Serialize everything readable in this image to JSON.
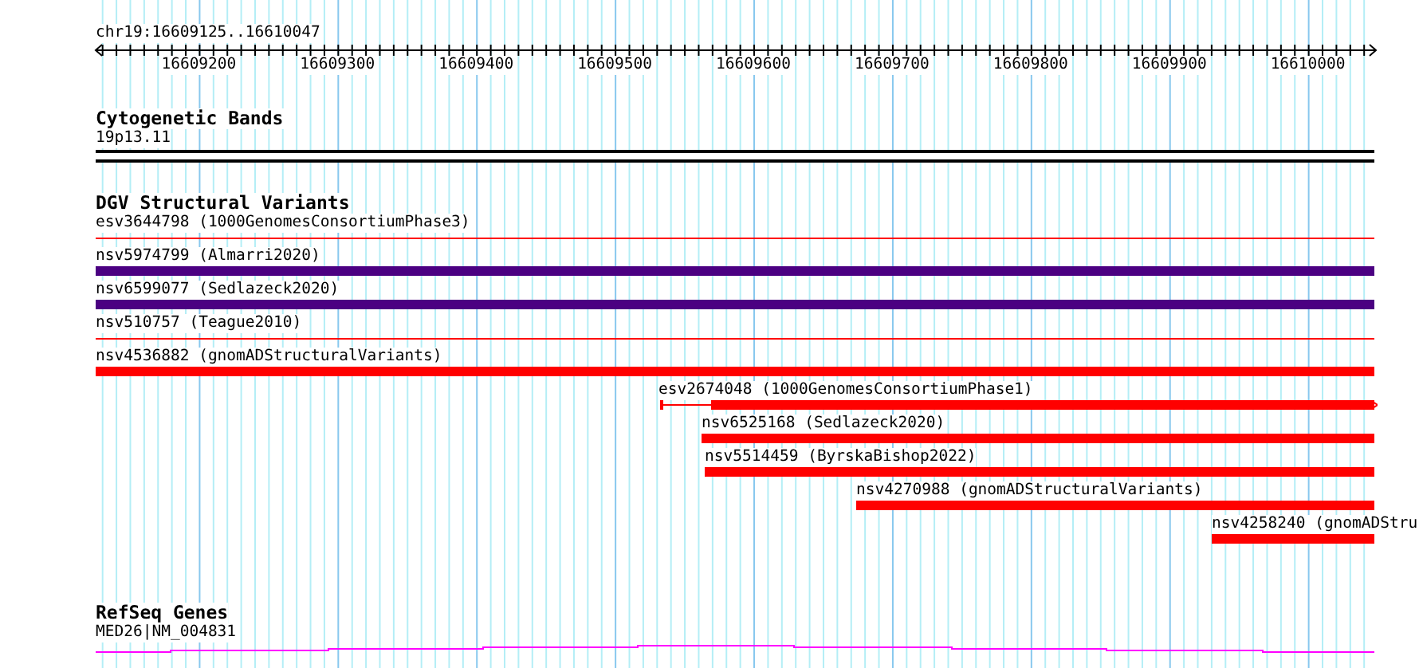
{
  "locus": "chr19:16609125..16610047",
  "ruler": {
    "labels": [
      "16609200",
      "16609300",
      "16609400",
      "16609500",
      "16609600",
      "16609700",
      "16609800",
      "16609900",
      "16610000"
    ]
  },
  "cytogenetic_bands": {
    "title": "Cytogenetic Bands",
    "features": [
      {
        "label": "19p13.11"
      }
    ]
  },
  "dgv_structural_variants": {
    "title": "DGV Structural Variants",
    "features": [
      {
        "label": "esv3644798 (1000GenomesConsortiumPhase3)",
        "kind": "line",
        "color": "#ff0000"
      },
      {
        "label": "nsv5974799 (Almarri2020)",
        "kind": "bar",
        "color": "#4b0082"
      },
      {
        "label": "nsv6599077 (Sedlazeck2020)",
        "kind": "bar",
        "color": "#4b0082"
      },
      {
        "label": "nsv510757 (Teague2010)",
        "kind": "line",
        "color": "#ff0000"
      },
      {
        "label": "nsv4536882 (gnomADStructuralVariants)",
        "kind": "bar",
        "color": "#ff0000"
      },
      {
        "label": "esv2674048 (1000GenomesConsortiumPhase1)",
        "kind": "partial",
        "color": "#ff0000"
      },
      {
        "label": "nsv6525168 (Sedlazeck2020)",
        "kind": "bar",
        "color": "#ff0000"
      },
      {
        "label": "nsv5514459 (ByrskaBishop2022)",
        "kind": "bar",
        "color": "#ff0000"
      },
      {
        "label": "nsv4270988 (gnomADStructuralVariants)",
        "kind": "bar",
        "color": "#ff0000"
      },
      {
        "label": "nsv4258240 (gnomADStru",
        "kind": "bar",
        "color": "#ff0000"
      }
    ]
  },
  "refseq_genes": {
    "title": "RefSeq Genes",
    "features": [
      {
        "label": "MED26|NM_004831"
      }
    ]
  }
}
